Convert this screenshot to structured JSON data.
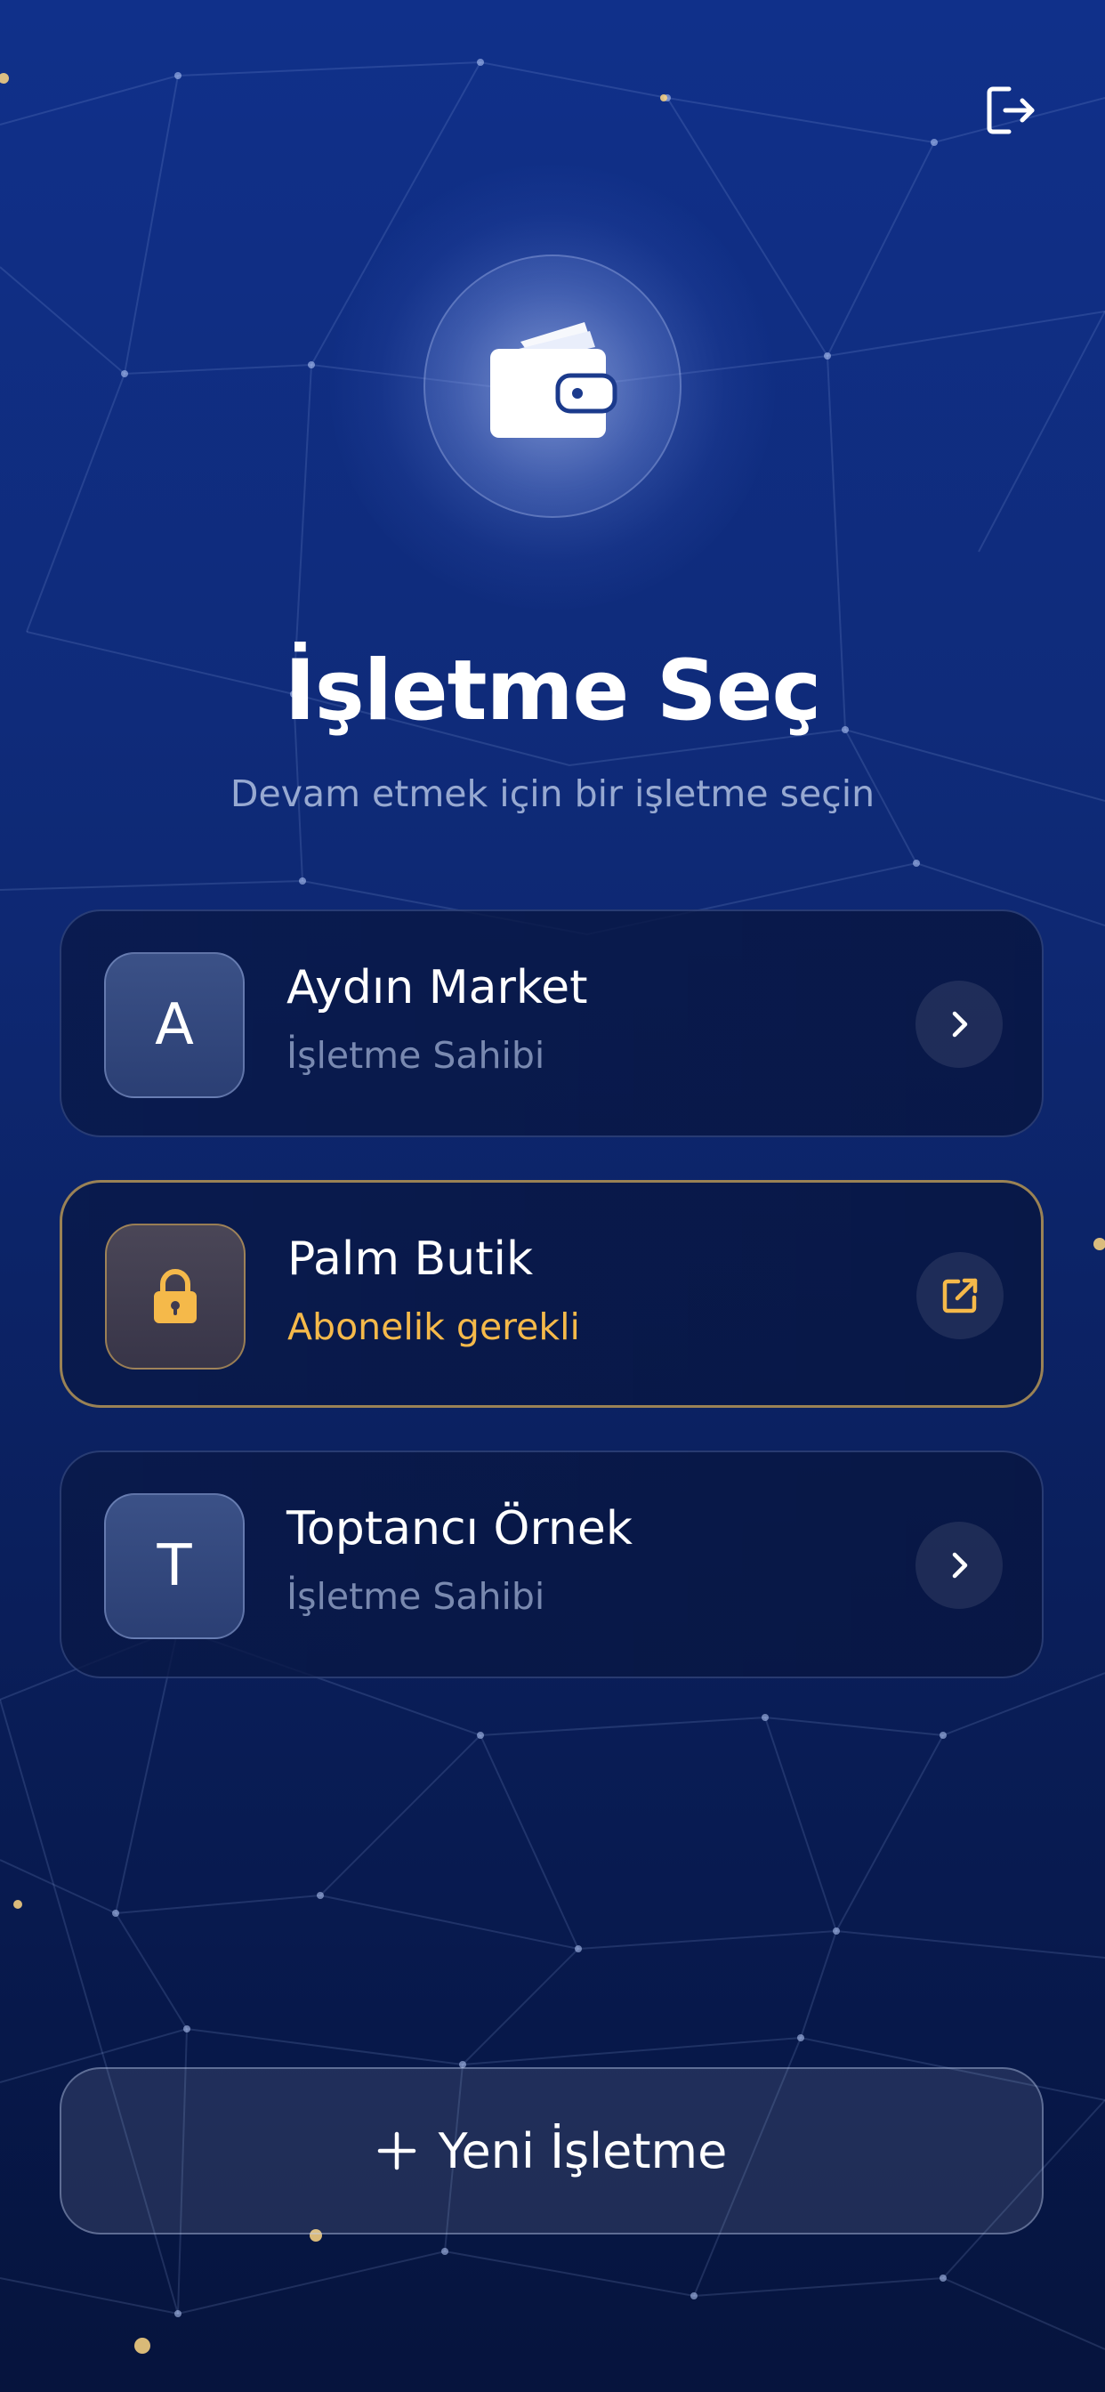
{
  "header": {
    "logout_icon": "logout-icon",
    "hero_icon": "wallet-icon"
  },
  "page": {
    "title": "İşletme Seç",
    "subtitle": "Devam etmek için bir işletme seçin"
  },
  "businesses": [
    {
      "initial": "A",
      "name": "Aydın Market",
      "role": "İşletme Sahibi",
      "action_icon": "chevron-right-icon",
      "locked": false
    },
    {
      "initial": "",
      "name": "Palm Butik",
      "role": "Abonelik gerekli",
      "action_icon": "external-link-icon",
      "avatar_icon": "lock-icon",
      "locked": true
    },
    {
      "initial": "T",
      "name": "Toptancı Örnek",
      "role": "İşletme Sahibi",
      "action_icon": "chevron-right-icon",
      "locked": false
    }
  ],
  "new_business_button": {
    "label": "Yeni İşletme",
    "icon": "plus-icon"
  },
  "colors": {
    "background_top": "#10308a",
    "background_bottom": "#06143d",
    "warning_accent": "#f5b94a",
    "locked_border": "#c4a058"
  }
}
